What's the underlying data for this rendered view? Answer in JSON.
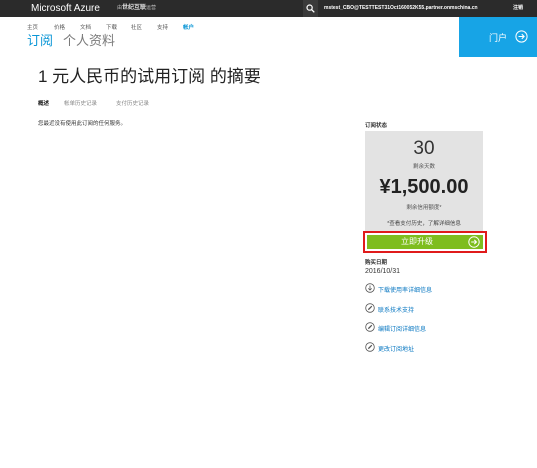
{
  "topbar": {
    "brand": "Microsoft Azure",
    "partner_name": "世纪互联",
    "partner_prefix": "由",
    "partner_suffix": "运营",
    "account": "mstest_CBO@TESTTEST31Oct160052K55.partner.onmschina.cn",
    "signout": "注销"
  },
  "nav": {
    "items": [
      {
        "label": "主页"
      },
      {
        "label": "价格"
      },
      {
        "label": "文档"
      },
      {
        "label": "下载"
      },
      {
        "label": "社区"
      },
      {
        "label": "支持"
      },
      {
        "label": "帐户"
      }
    ]
  },
  "page_tabs": {
    "subscriptions": "订阅",
    "profile": "个人资料"
  },
  "portal": {
    "label": "门户"
  },
  "main": {
    "title": "1 元人民币的试用订阅 的摘要",
    "subtabs": [
      "概述",
      "帐单历史记录",
      "支付历史记录"
    ],
    "message": "您最近没有使用此订阅的任何服务。"
  },
  "status": {
    "heading": "订阅状态",
    "days_value": "30",
    "days_label": "剩余天数",
    "credit_value": "¥1,500.00",
    "credit_label": "剩余信用额度*",
    "history_note": "*查看支付历史，了解详细信息",
    "upgrade_label": "立即升级",
    "purchase_heading": "购买日期",
    "purchase_date": "2016/10/31"
  },
  "links": [
    {
      "label": "下载使用率详细信息",
      "icon": "download-icon"
    },
    {
      "label": "联系技术支持",
      "icon": "edit-icon"
    },
    {
      "label": "编辑订阅详细信息",
      "icon": "edit-icon"
    },
    {
      "label": "更改订阅地址",
      "icon": "edit-icon"
    }
  ],
  "colors": {
    "accent": "#0a96d6",
    "portal": "#17a4e6",
    "upgrade": "#7ebd1e",
    "highlight": "#e01b1b",
    "topbar": "#2b2b2b"
  }
}
